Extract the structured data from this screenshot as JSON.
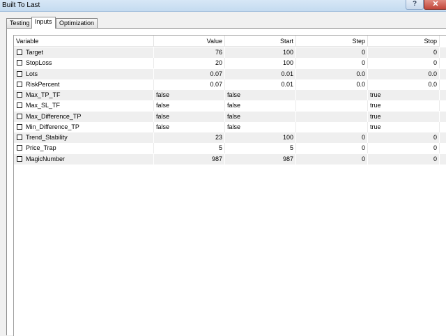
{
  "window": {
    "title": "Built To Last",
    "help_label": "?",
    "close_label": "✕"
  },
  "tabs": [
    {
      "label": "Testing",
      "active": false
    },
    {
      "label": "Inputs",
      "active": true
    },
    {
      "label": "Optimization",
      "active": false
    }
  ],
  "table": {
    "headers": [
      "Variable",
      "Value",
      "Start",
      "Step",
      "Stop"
    ],
    "rows": [
      {
        "name": "Target",
        "value": "76",
        "start": "100",
        "step": "0",
        "stop": "0"
      },
      {
        "name": "StopLoss",
        "value": "20",
        "start": "100",
        "step": "0",
        "stop": "0"
      },
      {
        "name": "Lots",
        "value": "0.07",
        "start": "0.01",
        "step": "0.0",
        "stop": "0.0"
      },
      {
        "name": "RiskPercent",
        "value": "0.07",
        "start": "0.01",
        "step": "0.0",
        "stop": "0.0"
      },
      {
        "name": "Max_TP_TF",
        "value": "false",
        "start": "false",
        "step": "",
        "stop": "true"
      },
      {
        "name": "Max_SL_TF",
        "value": "false",
        "start": "false",
        "step": "",
        "stop": "true"
      },
      {
        "name": "Max_Difference_TP",
        "value": "false",
        "start": "false",
        "step": "",
        "stop": "true"
      },
      {
        "name": "Min_Difference_TP",
        "value": "false",
        "start": "false",
        "step": "",
        "stop": "true"
      },
      {
        "name": "Trend_Stability",
        "value": "23",
        "start": "100",
        "step": "0",
        "stop": "0"
      },
      {
        "name": "Price_Trap",
        "value": "5",
        "start": "5",
        "step": "0",
        "stop": "0"
      },
      {
        "name": "MagicNumber",
        "value": "987",
        "start": "987",
        "step": "0",
        "stop": "0"
      }
    ]
  }
}
